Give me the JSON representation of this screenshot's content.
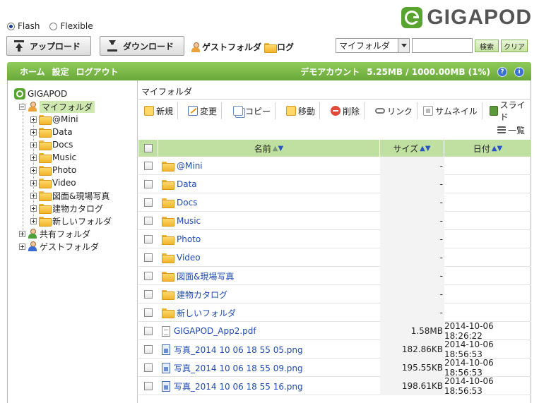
{
  "mode": {
    "options": [
      "Flash",
      "Flexible"
    ],
    "selected": "Flash"
  },
  "logo": {
    "text": "GIGAPOD",
    "color": "#58a42f"
  },
  "actions": {
    "upload_label": "アップロード",
    "download_label": "ダウンロード",
    "guest_folder_label": "ゲストフォルダ",
    "log_label": "ログ"
  },
  "search": {
    "scope_value": "マイフォルダ",
    "query": "",
    "search_label": "検索",
    "clear_label": "クリア"
  },
  "nav": {
    "home": "ホーム",
    "settings": "設定",
    "logout": "ログアウト"
  },
  "account": {
    "name": "デモアカウント",
    "usage": "5.25MB / 1000.00MB (1%)"
  },
  "tree": {
    "root": "GIGAPOD",
    "my_folder": "マイフォルダ",
    "children": [
      "@Mini",
      "Data",
      "Docs",
      "Music",
      "Photo",
      "Video",
      "図面&現場写真",
      "建物カタログ",
      "新しいフォルダ"
    ],
    "shared": "共有フォルダ",
    "guest": "ゲストフォルダ"
  },
  "breadcrumb": "マイフォルダ",
  "toolbar": {
    "new": "新規",
    "edit": "変更",
    "copy": "コピー",
    "move": "移動",
    "delete": "削除",
    "link": "リンク",
    "thumbnail": "サムネイル",
    "slide": "スライド",
    "list": "一覧"
  },
  "table": {
    "headers": {
      "name": "名前",
      "size": "サイズ",
      "date": "日付"
    },
    "rows": [
      {
        "type": "folder",
        "name": "@Mini",
        "size": "-",
        "date": ""
      },
      {
        "type": "folder",
        "name": "Data",
        "size": "-",
        "date": ""
      },
      {
        "type": "folder",
        "name": "Docs",
        "size": "-",
        "date": ""
      },
      {
        "type": "folder",
        "name": "Music",
        "size": "-",
        "date": ""
      },
      {
        "type": "folder",
        "name": "Photo",
        "size": "-",
        "date": ""
      },
      {
        "type": "folder",
        "name": "Video",
        "size": "-",
        "date": ""
      },
      {
        "type": "folder",
        "name": "図面&現場写真",
        "size": "-",
        "date": ""
      },
      {
        "type": "folder",
        "name": "建物カタログ",
        "size": "-",
        "date": ""
      },
      {
        "type": "folder",
        "name": "新しいフォルダ",
        "size": "-",
        "date": ""
      },
      {
        "type": "doc",
        "name": "GIGAPOD_App2.pdf",
        "size": "1.58MB",
        "date": "2014-10-06 18:26:22"
      },
      {
        "type": "image",
        "name": "写真_2014 10 06 18 55 05.png",
        "size": "182.86KB",
        "date": "2014-10-06 18:56:53"
      },
      {
        "type": "image",
        "name": "写真_2014 10 06 18 55 09.png",
        "size": "195.55KB",
        "date": "2014-10-06 18:56:53"
      },
      {
        "type": "image",
        "name": "写真_2014 10 06 18 55 16.png",
        "size": "198.61KB",
        "date": "2014-10-06 18:56:53"
      }
    ]
  },
  "colors": {
    "accent_green": "#6aa83a",
    "header_green": "#bfe0a0",
    "link_blue": "#1f4ab0"
  }
}
